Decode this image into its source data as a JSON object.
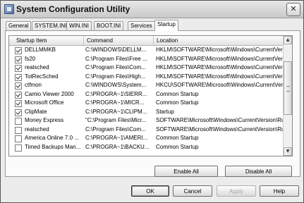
{
  "window": {
    "title": "System Configuration Utility",
    "close_glyph": "✕"
  },
  "tabs": [
    {
      "label": "General"
    },
    {
      "label": "SYSTEM.INI"
    },
    {
      "label": "WIN.INI"
    },
    {
      "label": "BOOT.INI"
    },
    {
      "label": "Services"
    },
    {
      "label": "Startup",
      "active": true
    }
  ],
  "list": {
    "columns": [
      "Startup Item",
      "Command",
      "Location"
    ],
    "rows": [
      {
        "checked": true,
        "item": "DELLMMKB",
        "command": "C:\\WINDOWS\\DELLM...",
        "location": "HKLM\\SOFTWARE\\Microsoft\\Windows\\CurrentVer..."
      },
      {
        "checked": true,
        "item": "fs20",
        "command": "C:\\Program Files\\Free ...",
        "location": "HKLM\\SOFTWARE\\Microsoft\\Windows\\CurrentVer..."
      },
      {
        "checked": true,
        "item": "realsched",
        "command": "C:\\Program Files\\Com...",
        "location": "HKLM\\SOFTWARE\\Microsoft\\Windows\\CurrentVer..."
      },
      {
        "checked": true,
        "item": "TotRecSched",
        "command": "C:\\Program Files\\High...",
        "location": "HKLM\\SOFTWARE\\Microsoft\\Windows\\CurrentVer..."
      },
      {
        "checked": true,
        "item": "ctfmon",
        "command": "C:\\WINDOWS\\System...",
        "location": "HKCU\\SOFTWARE\\Microsoft\\Windows\\CurrentVer..."
      },
      {
        "checked": true,
        "item": "Camio Viewer 2000",
        "command": "C:\\PROGRA~1\\SIERR...",
        "location": "Common Startup"
      },
      {
        "checked": true,
        "item": "Microsoft Office",
        "command": "C:\\PROGRA~1\\MICR...",
        "location": "Common Startup"
      },
      {
        "checked": true,
        "item": "ClipMate",
        "command": "C:\\PROGRA~1\\CLIPM...",
        "location": "Startup"
      },
      {
        "checked": false,
        "item": "Money Express",
        "command": "\"C:\\Program Files\\Micr...",
        "location": "SOFTWARE\\Microsoft\\Windows\\CurrentVersion\\Ru..."
      },
      {
        "checked": false,
        "item": "realsched",
        "command": "C:\\Program Files\\Com...",
        "location": "SOFTWARE\\Microsoft\\Windows\\CurrentVersion\\Ru..."
      },
      {
        "checked": false,
        "item": "America Online 7.0 ...",
        "command": "C:\\PROGRA~1\\AMERI...",
        "location": "Common Startup"
      },
      {
        "checked": false,
        "item": "Timed Backups Man...",
        "command": "C:\\PROGRA~1\\BACKU...",
        "location": "Common Startup"
      }
    ]
  },
  "buttons": {
    "enable_all": "Enable All",
    "disable_all": "Disable All",
    "ok": "OK",
    "cancel": "Cancel",
    "apply": "Apply",
    "help": "Help"
  },
  "icons": {
    "app": "system-config-icon",
    "scroll_up": "▲",
    "scroll_down": "▼"
  }
}
